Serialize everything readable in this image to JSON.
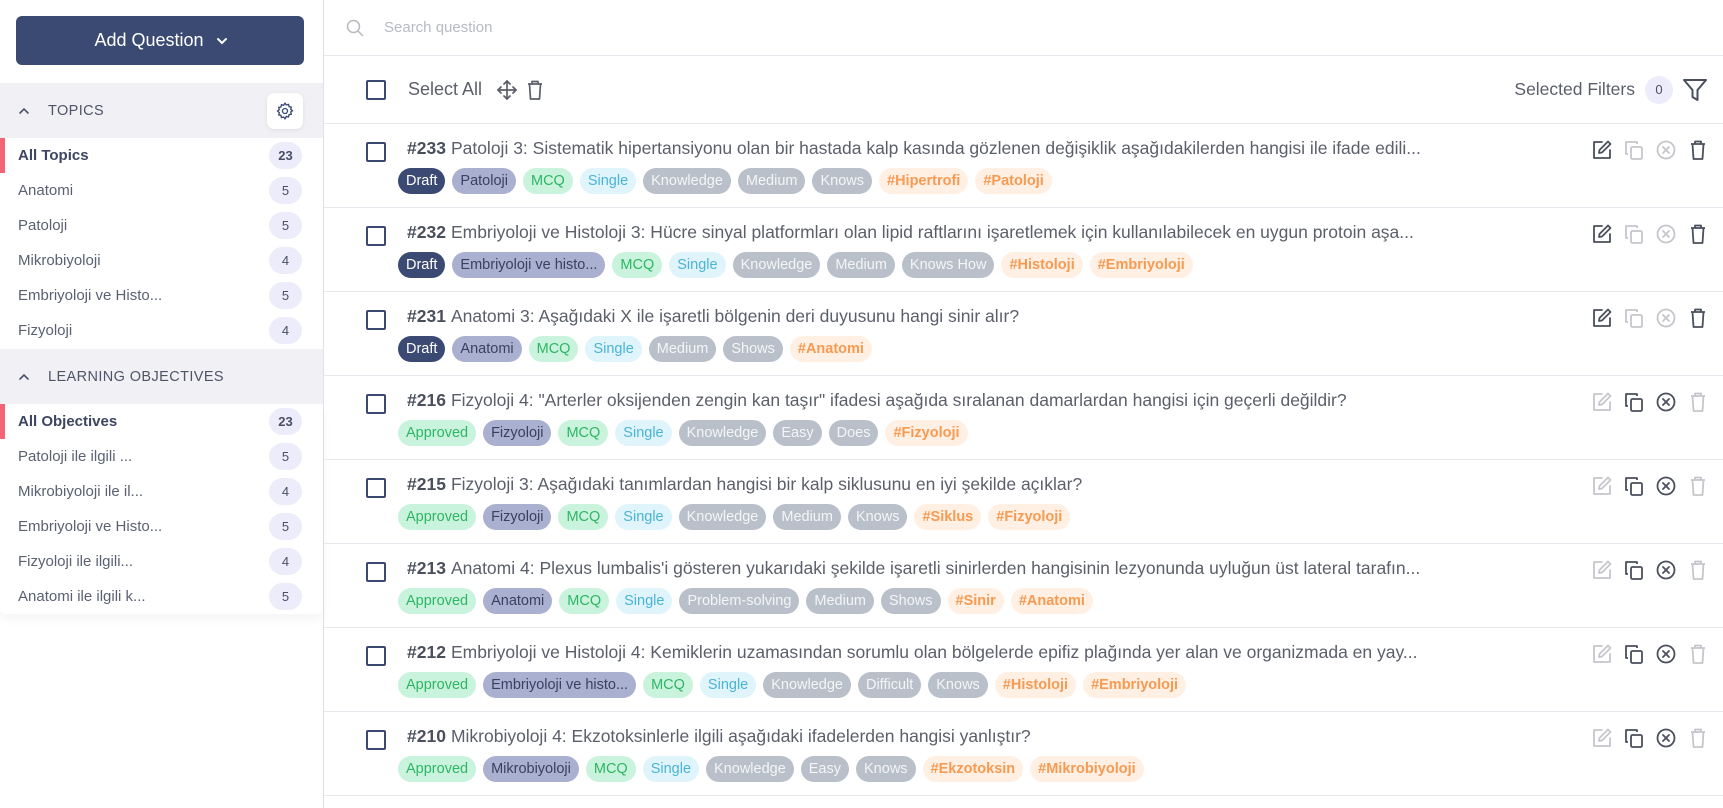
{
  "sidebar": {
    "add_button": "Add Question",
    "topics": {
      "header": "TOPICS",
      "items": [
        {
          "label": "All Topics",
          "count": "23",
          "active": true
        },
        {
          "label": "Anatomi",
          "count": "5"
        },
        {
          "label": "Patoloji",
          "count": "5"
        },
        {
          "label": "Mikrobiyoloji",
          "count": "4"
        },
        {
          "label": "Embriyoloji ve Histo...",
          "count": "5"
        },
        {
          "label": "Fizyoloji",
          "count": "4"
        }
      ]
    },
    "objectives": {
      "header": "LEARNING OBJECTIVES",
      "items": [
        {
          "label": "All Objectives",
          "count": "23",
          "active": true
        },
        {
          "label": "Patoloji ile ilgili ...",
          "count": "5"
        },
        {
          "label": "Mikrobiyoloji ile il...",
          "count": "4"
        },
        {
          "label": "Embriyoloji ve Histo...",
          "count": "5"
        },
        {
          "label": "Fizyoloji ile ilgili...",
          "count": "4"
        },
        {
          "label": "Anatomi ile ilgili k...",
          "count": "5"
        }
      ]
    }
  },
  "search": {
    "placeholder": "Search question",
    "value": ""
  },
  "toolbar": {
    "select_all": "Select All",
    "filters_label": "Selected Filters",
    "filters_count": "0"
  },
  "colors": {
    "primary": "#3b4a72",
    "active_marker": "#f56476",
    "approved": "#2fb566",
    "hashtag": "#f79a52"
  },
  "questions": [
    {
      "id": "#233",
      "title": "Patoloji 3: Sistematik hipertansiyonu olan bir hastada kalp kasında gözlenen değişiklik aşağıdakilerden hangisi ile ifade edili...",
      "status": "Draft",
      "topic": "Patoloji",
      "type": "MCQ",
      "answer": "Single",
      "meta": [
        "Knowledge",
        "Medium",
        "Knows"
      ],
      "hashtags": [
        "#Hipertrofi",
        "#Patoloji"
      ]
    },
    {
      "id": "#232",
      "title": "Embriyoloji ve Histoloji 3: Hücre sinyal platformları olan lipid raftlarını işaretlemek için kullanılabilecek en uygun protoin aşa...",
      "status": "Draft",
      "topic": "Embriyoloji ve histo...",
      "type": "MCQ",
      "answer": "Single",
      "meta": [
        "Knowledge",
        "Medium",
        "Knows How"
      ],
      "hashtags": [
        "#Histoloji",
        "#Embriyoloji"
      ]
    },
    {
      "id": "#231",
      "title": "Anatomi 3: Aşağıdaki X ile işaretli bölgenin deri duyusunu hangi sinir alır?",
      "status": "Draft",
      "topic": "Anatomi",
      "type": "MCQ",
      "answer": "Single",
      "meta": [
        "Medium",
        "Shows"
      ],
      "hashtags": [
        "#Anatomi"
      ]
    },
    {
      "id": "#216",
      "title": "Fizyoloji 4: \"Arterler oksijenden zengin kan taşır\" ifadesi aşağıda sıralanan damarlardan hangisi için geçerli değildir?",
      "status": "Approved",
      "topic": "Fizyoloji",
      "type": "MCQ",
      "answer": "Single",
      "meta": [
        "Knowledge",
        "Easy",
        "Does"
      ],
      "hashtags": [
        "#Fizyoloji"
      ]
    },
    {
      "id": "#215",
      "title": "Fizyoloji 3: Aşağıdaki tanımlardan hangisi bir kalp siklusunu en iyi şekilde açıklar?",
      "status": "Approved",
      "topic": "Fizyoloji",
      "type": "MCQ",
      "answer": "Single",
      "meta": [
        "Knowledge",
        "Medium",
        "Knows"
      ],
      "hashtags": [
        "#Siklus",
        "#Fizyoloji"
      ]
    },
    {
      "id": "#213",
      "title": "Anatomi 4: Plexus lumbalis'i gösteren yukarıdaki şekilde işaretli sinirlerden hangisinin lezyonunda uyluğun üst lateral tarafın...",
      "status": "Approved",
      "topic": "Anatomi",
      "type": "MCQ",
      "answer": "Single",
      "meta": [
        "Problem-solving",
        "Medium",
        "Shows"
      ],
      "hashtags": [
        "#Sinir",
        "#Anatomi"
      ]
    },
    {
      "id": "#212",
      "title": "Embriyoloji ve Histoloji 4: Kemiklerin uzamasından sorumlu olan bölgelerde epifiz plağında yer alan ve organizmada en yay...",
      "status": "Approved",
      "topic": "Embriyoloji ve histo...",
      "type": "MCQ",
      "answer": "Single",
      "meta": [
        "Knowledge",
        "Difficult",
        "Knows"
      ],
      "hashtags": [
        "#Histoloji",
        "#Embriyoloji"
      ]
    },
    {
      "id": "#210",
      "title": "Mikrobiyoloji 4: Ekzotoksinlerle ilgili aşağıdaki ifadelerden hangisi yanlıştır?",
      "status": "Approved",
      "topic": "Mikrobiyoloji",
      "type": "MCQ",
      "answer": "Single",
      "meta": [
        "Knowledge",
        "Easy",
        "Knows"
      ],
      "hashtags": [
        "#Ekzotoksin",
        "#Mikrobiyoloji"
      ]
    }
  ]
}
